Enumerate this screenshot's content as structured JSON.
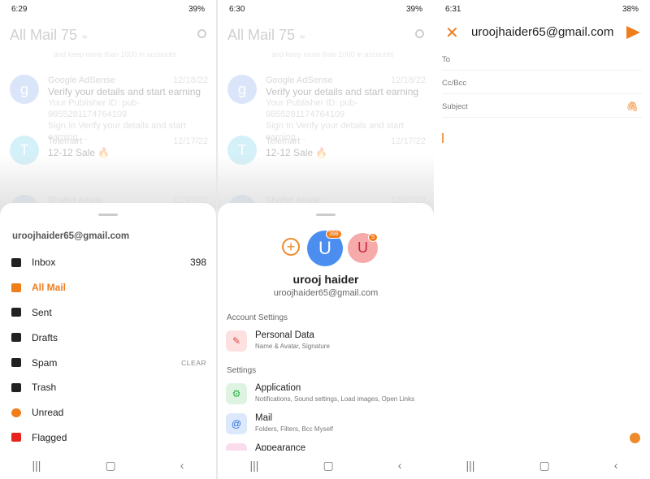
{
  "screens": [
    {
      "status": {
        "time": "6:29",
        "battery": "39%"
      }
    },
    {
      "status": {
        "time": "6:30",
        "battery": "39%"
      }
    },
    {
      "status": {
        "time": "6:31",
        "battery": "38%"
      }
    }
  ],
  "list": {
    "title": "All Mail 75",
    "clipped_text": "and keep more than 1000 in accounts",
    "mails": [
      {
        "avatar": "g",
        "avatar_color": "#7fa3f0",
        "sender": "Google AdSense",
        "date": "12/18/22",
        "subject": "Verify your details and start earning",
        "preview1": "Your Publisher ID: pub-9855281174764109",
        "preview2": "Sign In Verify your details and start earning ..."
      },
      {
        "avatar": "T",
        "avatar_color": "#67cce8",
        "sender": "Telemart",
        "date": "12/17/22",
        "subject": "12-12 Sale 🔥"
      },
      {
        "avatar": "",
        "avatar_color": "#5b9bd5",
        "sender": "Shahid Anwar",
        "date": "12/17/22"
      }
    ]
  },
  "folders": {
    "account": "uroojhaider65@gmail.com",
    "items": [
      {
        "label": "Inbox",
        "count": "398",
        "icon": "inbox-icon",
        "color": "#222"
      },
      {
        "label": "All Mail",
        "icon": "all-mail-icon",
        "color": "#ef7d1c",
        "active": true
      },
      {
        "label": "Sent",
        "icon": "reply-icon",
        "color": "#222"
      },
      {
        "label": "Drafts",
        "icon": "drafts-icon",
        "color": "#222"
      },
      {
        "label": "Spam",
        "action": "CLEAR",
        "icon": "thumbs-down-icon",
        "color": "#222"
      },
      {
        "label": "Trash",
        "icon": "trash-icon",
        "color": "#222"
      },
      {
        "label": "Unread",
        "icon": "dot-icon",
        "color": "#ef7d1c"
      },
      {
        "label": "Flagged",
        "icon": "flag-icon",
        "color": "#e8231c"
      }
    ]
  },
  "account": {
    "avatar": "U",
    "badge": "398",
    "second_avatar": "U",
    "second_badge": "5",
    "name": "urooj haider",
    "email": "uroojhaider65@gmail.com",
    "account_settings_label": "Account Settings",
    "settings_label": "Settings",
    "personal": {
      "title": "Personal Data",
      "subtitle": "Name & Avatar, Signature"
    },
    "items": [
      {
        "title": "Application",
        "subtitle": "Notifications, Sound settings, Load images, Open Links",
        "icon": "gear-icon",
        "bg": "#dff3e2",
        "fg": "#2fb34a"
      },
      {
        "title": "Mail",
        "subtitle": "Folders, Filters, Bcc Myself",
        "icon": "at-icon",
        "bg": "#dce8fb",
        "fg": "#2a6de0"
      },
      {
        "title": "Appearance",
        "subtitle": "",
        "icon": "appearance-icon",
        "bg": "#fbdcec",
        "fg": "#e0428e"
      }
    ]
  },
  "compose": {
    "from": "uroojhaider65@gmail.com",
    "to_label": "To",
    "cc_label": "Cc/Bcc",
    "subject_label": "Subject"
  },
  "accent": "#ef7d1c"
}
